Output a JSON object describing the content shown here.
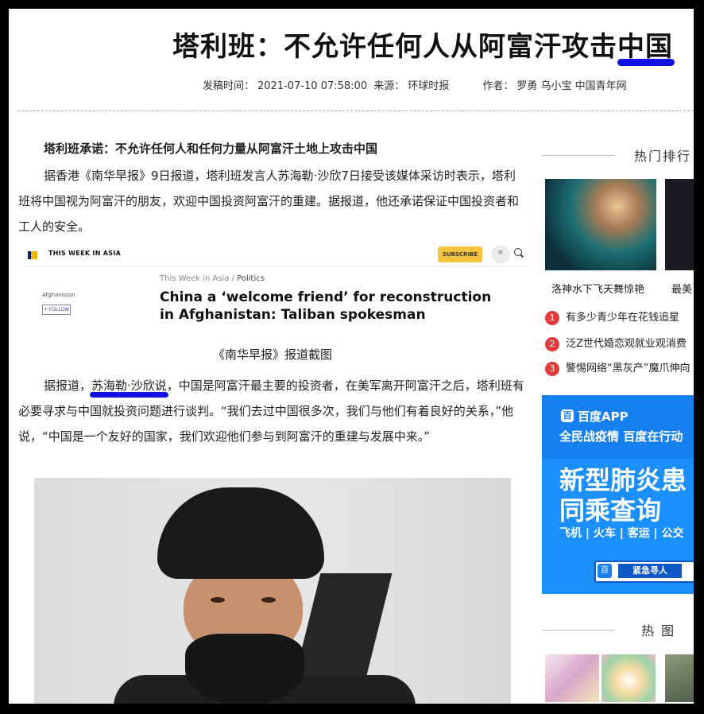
{
  "article": {
    "title": "塔利班：不允许任何人从阿富汗攻击中国",
    "meta": {
      "publish_label": "发稿时间：",
      "publish_time": "2021-07-10 07:58:00",
      "source_label": "来源：",
      "source": "环球时报",
      "author_label": "作者：",
      "authors": "罗勇 乌小宝 中国青年网"
    },
    "lead": "塔利班承诺：不允许任何人和任何力量从阿富汗土地上攻击中国",
    "para1": "据香港《南华早报》9日报道，塔利班发言人苏海勒·沙欣7日接受该媒体采访时表示，塔利班将中国视为阿富汗的朋友，欢迎中国投资阿富汗的重建。据报道，他还承诺保证中国投资者和工人的安全。",
    "embed": {
      "brand": "THIS WEEK IN ASIA",
      "subscribe": "SUBSCRIBE",
      "side_label": "Afghanistan",
      "follow": "+ FOLLOW",
      "crumb_1": "This Week in Asia /",
      "crumb_2": "Politics",
      "headline": "China a ‘welcome friend’ for reconstruction in Afghanistan: Taliban spokesman"
    },
    "caption": "《南华早报》报道截图",
    "para2_pre": "据报道，",
    "para2_name": "苏海勒·沙欣说",
    "para2_post": "，中国是阿富汗最主要的投资者，在美军离开阿富汗之后，塔利班有必要寻求与中国就投资问题进行谈判。“我们去过中国很多次，我们与他们有着良好的关系，”他说，“中国是一个友好的国家，我们欢迎他们参与到阿富汗的重建与发展中来。”"
  },
  "sidebar": {
    "hot_title": "热门排行",
    "thumb_captions": [
      "洛神水下飞天舞惊艳",
      "最美"
    ],
    "ranks": [
      {
        "num": "1",
        "text": "有多少青少年在花钱追星"
      },
      {
        "num": "2",
        "text": "泛Z世代婚恋观就业观消费"
      },
      {
        "num": "3",
        "text": "警惕网络“黑灰产”魔爪伸向"
      }
    ],
    "ad": {
      "logo": "百",
      "app": "百度APP",
      "slogan": "全民战疫情 百度在行动",
      "big1": "新型肺炎患",
      "big2": "同乘查询",
      "modes": "飞机 | 火车 | 客运 | 公交",
      "logo2": "百",
      "button": "紧急寻人"
    },
    "pic_title": "热 图"
  }
}
